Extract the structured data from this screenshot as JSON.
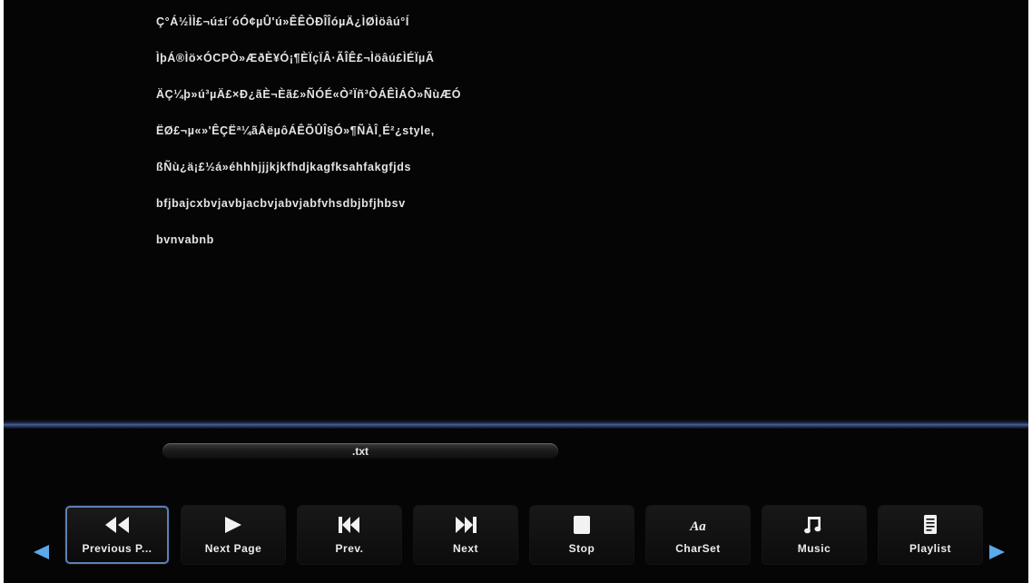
{
  "document": {
    "lines": [
      "Ç°Á½ÌÌ£¬ú±í´óÓ¢µÛ'ú»ÊÊÒÐÎÎóµÄ¿ÌØÌöâú°Í",
      "ÌþÁ®Ìö×ÓCPÒ»ÆðÈ¥Ó¡¶ÈÏçÏÂ·ÃÎÊ£¬Ìöâú£ÌÉÏµÃ",
      "ÄÇ¼þ»ú³µÄ£×Ð¿ãÈ¬Èã£»ÑÓÉ«Ò²Ïñ³ÒÁÊÌÁÒ»ÑùÆÓ",
      "ËØ£¬µ«»'ÊÇËª¼ãÂëµôÁÊÕÛÎ§Ó»¶ÑÀÎ¸É²¿style,",
      "ßÑù¿ä¡£½á»éhhhjjjkjkfhdjkagfksahfakgfjds",
      "bfjbajcxbvjavbjacbvjabvjabfvhsdbjbfjhbsv",
      "bvnvabnb"
    ]
  },
  "file_bar": {
    "name": ".txt"
  },
  "toolbar": {
    "buttons": [
      {
        "label": "Previous P...",
        "icon": "rewind-icon",
        "selected": true
      },
      {
        "label": "Next Page",
        "icon": "play-icon",
        "selected": false
      },
      {
        "label": "Prev.",
        "icon": "skip-previous-icon",
        "selected": false
      },
      {
        "label": "Next",
        "icon": "skip-next-icon",
        "selected": false
      },
      {
        "label": "Stop",
        "icon": "stop-icon",
        "selected": false
      },
      {
        "label": "CharSet",
        "icon": "charset-icon",
        "selected": false
      },
      {
        "label": "Music",
        "icon": "music-note-icon",
        "selected": false
      },
      {
        "label": "Playlist",
        "icon": "playlist-icon",
        "selected": false
      }
    ],
    "charset_icon_text": "Aa"
  },
  "colors": {
    "background": "#050505",
    "text": "#e4e4e4",
    "selection_border": "#5d7fb8",
    "arrow": "#5aa9ea"
  }
}
